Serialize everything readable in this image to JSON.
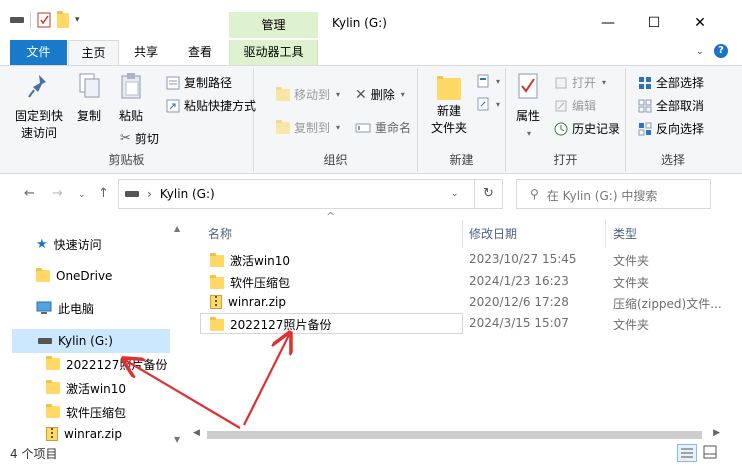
{
  "window": {
    "title": "Kylin (G:)",
    "context_tab_header": "管理"
  },
  "tabs": {
    "file": "文件",
    "home": "主页",
    "share": "共享",
    "view": "查看",
    "drive_tools": "驱动器工具"
  },
  "ribbon": {
    "clipboard": {
      "label": "剪贴板",
      "pin": "固定到快\n速访问",
      "copy": "复制",
      "paste": "粘贴",
      "copy_path": "复制路径",
      "paste_shortcut": "粘贴快捷方式",
      "cut": "剪切"
    },
    "organize": {
      "label": "组织",
      "move_to": "移动到",
      "copy_to": "复制到",
      "delete": "删除",
      "rename": "重命名"
    },
    "new": {
      "label": "新建",
      "new_folder": "新建\n文件夹"
    },
    "open": {
      "label": "打开",
      "properties": "属性",
      "open": "打开",
      "edit": "编辑",
      "history": "历史记录"
    },
    "select": {
      "label": "选择",
      "select_all": "全部选择",
      "select_none": "全部取消",
      "invert": "反向选择"
    }
  },
  "address": {
    "path": "Kylin (G:)",
    "search_placeholder": "在 Kylin (G:) 中搜索"
  },
  "nav_pane": {
    "quick_access": "快速访问",
    "onedrive": "OneDrive",
    "this_pc": "此电脑",
    "drive": "Kylin (G:)",
    "children": [
      "2022127照片备份",
      "激活win10",
      "软件压缩包",
      "winrar.zip"
    ]
  },
  "columns": {
    "name": "名称",
    "date": "修改日期",
    "type": "类型"
  },
  "files": [
    {
      "name": "激活win10",
      "date": "2023/10/27 15:45",
      "type": "文件夹",
      "icon": "folder-icon"
    },
    {
      "name": "软件压缩包",
      "date": "2024/1/23 16:23",
      "type": "文件夹",
      "icon": "folder-icon"
    },
    {
      "name": "winrar.zip",
      "date": "2020/12/6 17:28",
      "type": "压缩(zipped)文件...",
      "icon": "zip-icon"
    },
    {
      "name": "2022127照片备份",
      "date": "2024/3/15 15:07",
      "type": "文件夹",
      "icon": "folder-icon"
    }
  ],
  "status": {
    "count": "4 个项目"
  },
  "colors": {
    "file_tab": "#1979ca",
    "context_tab": "#dff2cf",
    "selection": "#cce8ff",
    "annotation_arrow": "#e03030"
  }
}
